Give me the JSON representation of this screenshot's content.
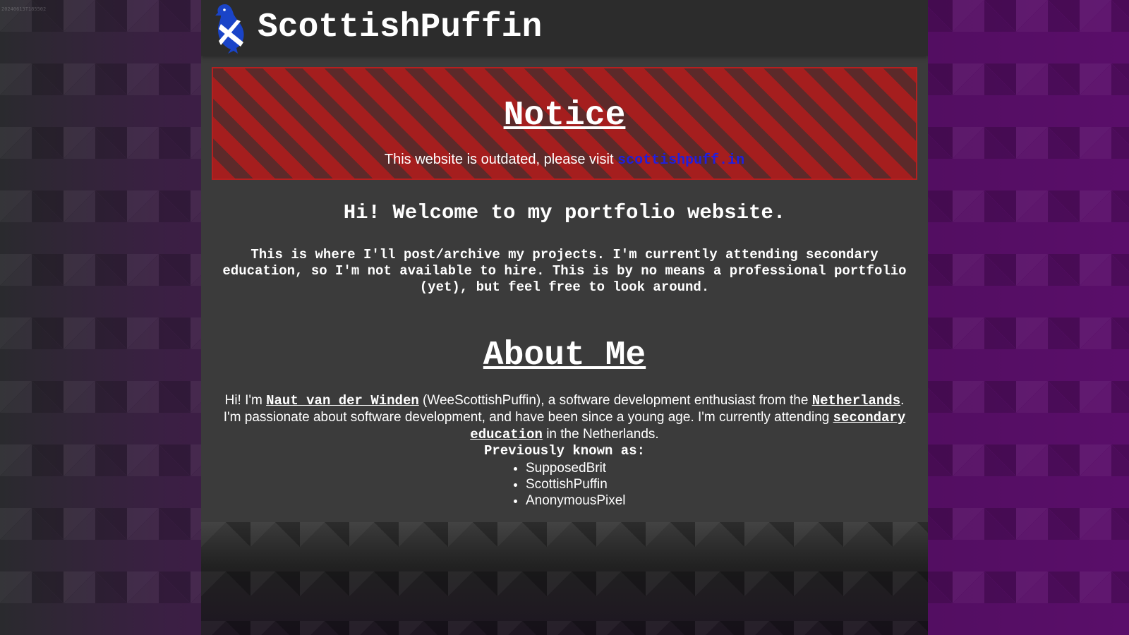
{
  "timestamp_stamp": "20240613T185502",
  "header": {
    "site_title": "ScottishPuffin",
    "logo_icon": "puffin-saltire-logo-icon"
  },
  "notice": {
    "title": "Notice",
    "text": "This website is outdated, please visit ",
    "link_label": "scottishpuff.in"
  },
  "welcome": {
    "heading": "Hi! Welcome to my portfolio website.",
    "intro": "This is where I'll post/archive my projects. I'm currently attending secondary education, so I'm not available to hire. This is by no means a professional portfolio (yet), but feel free to look around."
  },
  "about": {
    "title": "About Me",
    "text_1": "Hi! I'm ",
    "name_link": "Naut van der Winden",
    "text_2": " (WeeScottishPuffin), a software development enthusiast from the ",
    "country_link": "Netherlands",
    "text_3": ". I'm passionate about software development, and have been since a young age. I'm currently attending ",
    "education_link": "secondary education",
    "text_4": " in the Netherlands.",
    "known_as_label": "Previously known as:",
    "known_as": [
      "SupposedBrit",
      "ScottishPuffin",
      "AnonymousPixel"
    ]
  },
  "colors": {
    "notice_red": "#a51e1e",
    "notice_link": "#1f1fe0",
    "page_bg": "#3b3b3b",
    "header_bg": "#2c2c2c",
    "outer_purple": "#4a0e57"
  }
}
